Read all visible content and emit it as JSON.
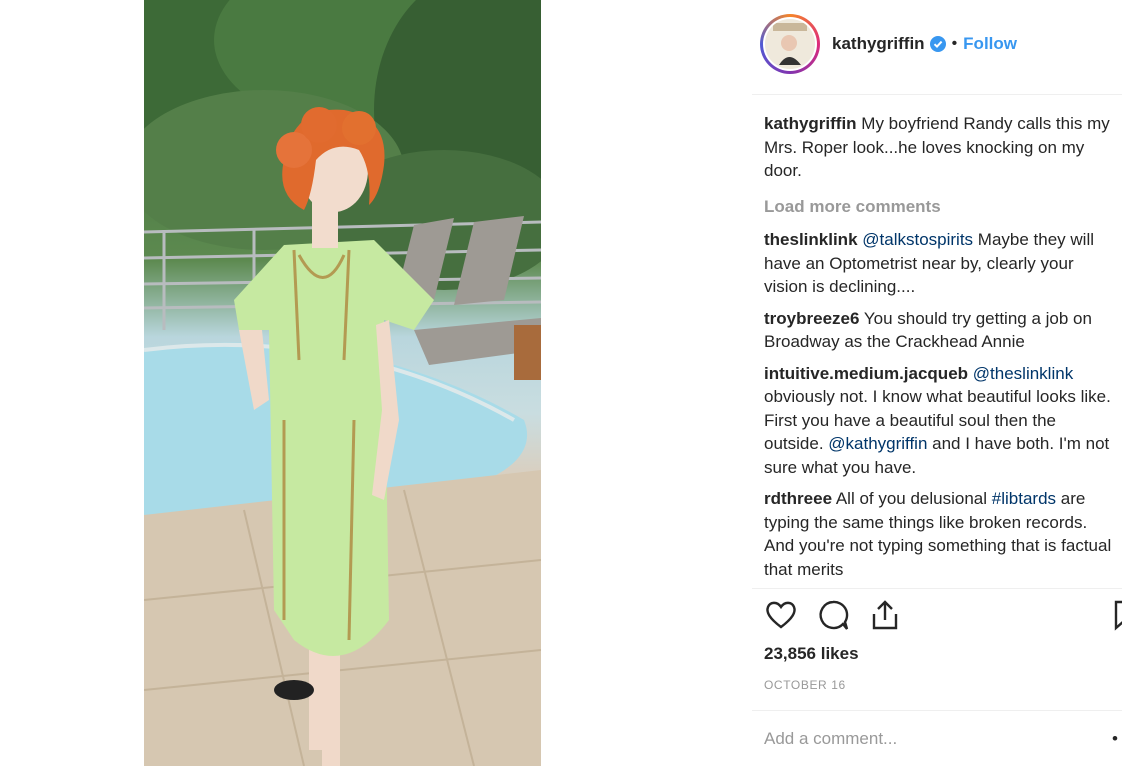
{
  "post": {
    "username": "kathygriffin",
    "separator": "•",
    "follow_label": "Follow",
    "caption_user": "kathygriffin",
    "caption_text": "My boyfriend Randy calls this my Mrs. Roper look...he loves knocking on my door.",
    "load_more": "Load more comments",
    "likes": "23,856 likes",
    "date": "OCTOBER 16",
    "comment_placeholder": "Add a comment...",
    "more_options": "•"
  },
  "comments": [
    {
      "user": "theslinklink",
      "mention": "@talkstospirits",
      "text": " Maybe they will have an Optometrist near by, clearly your vision is declining...."
    },
    {
      "user": "troybreeze6",
      "mention": "",
      "text": "You should try getting a job on Broadway as the Crackhead Annie"
    },
    {
      "user": "intuitive.medium.jacqueb",
      "mention": "@theslinklink",
      "text": " obviously not. I know what beautiful looks like. First you have a beautiful soul then the outside. ",
      "mention2": "@kathygriffin",
      "text2": " and I have both. I'm not sure what you have."
    },
    {
      "user": "rdthreee",
      "text_pre": "All of you delusional ",
      "hashtag": "#libtards",
      "text": " are typing the same things like broken records. And you're not typing something that is factual that merits"
    }
  ],
  "icons": {
    "verified": "verified-badge-icon",
    "like": "heart-icon",
    "comment": "comment-bubble-icon",
    "share": "share-icon",
    "save": "bookmark-icon"
  },
  "colors": {
    "link": "#3897f0",
    "mention": "#003569",
    "muted": "#999999",
    "text": "#262626"
  }
}
